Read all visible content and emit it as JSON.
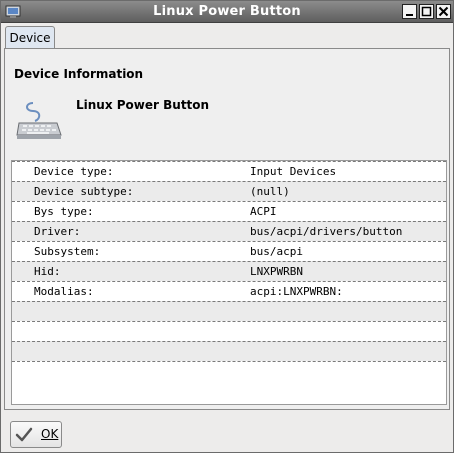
{
  "window": {
    "title": "Linux Power Button"
  },
  "tabs": [
    {
      "label": "Device"
    }
  ],
  "device_info": {
    "section_title": "Device Information",
    "device_name": "Linux Power Button",
    "icon": "keyboard-icon"
  },
  "properties": [
    {
      "key": "Device type:",
      "value": "Input Devices"
    },
    {
      "key": "Device subtype:",
      "value": "(null)"
    },
    {
      "key": "Bys type:",
      "value": "ACPI"
    },
    {
      "key": "Driver:",
      "value": "bus/acpi/drivers/button"
    },
    {
      "key": "Subsystem:",
      "value": "bus/acpi"
    },
    {
      "key": "Hid:",
      "value": "LNXPWRBN"
    },
    {
      "key": "Modalias:",
      "value": "acpi:LNXPWRBN:"
    }
  ],
  "buttons": {
    "ok_label": "OK"
  },
  "colors": {
    "titlebar": "#6f6f6f",
    "tab": "#dfe7f1",
    "row_alt": "#ebebeb"
  }
}
